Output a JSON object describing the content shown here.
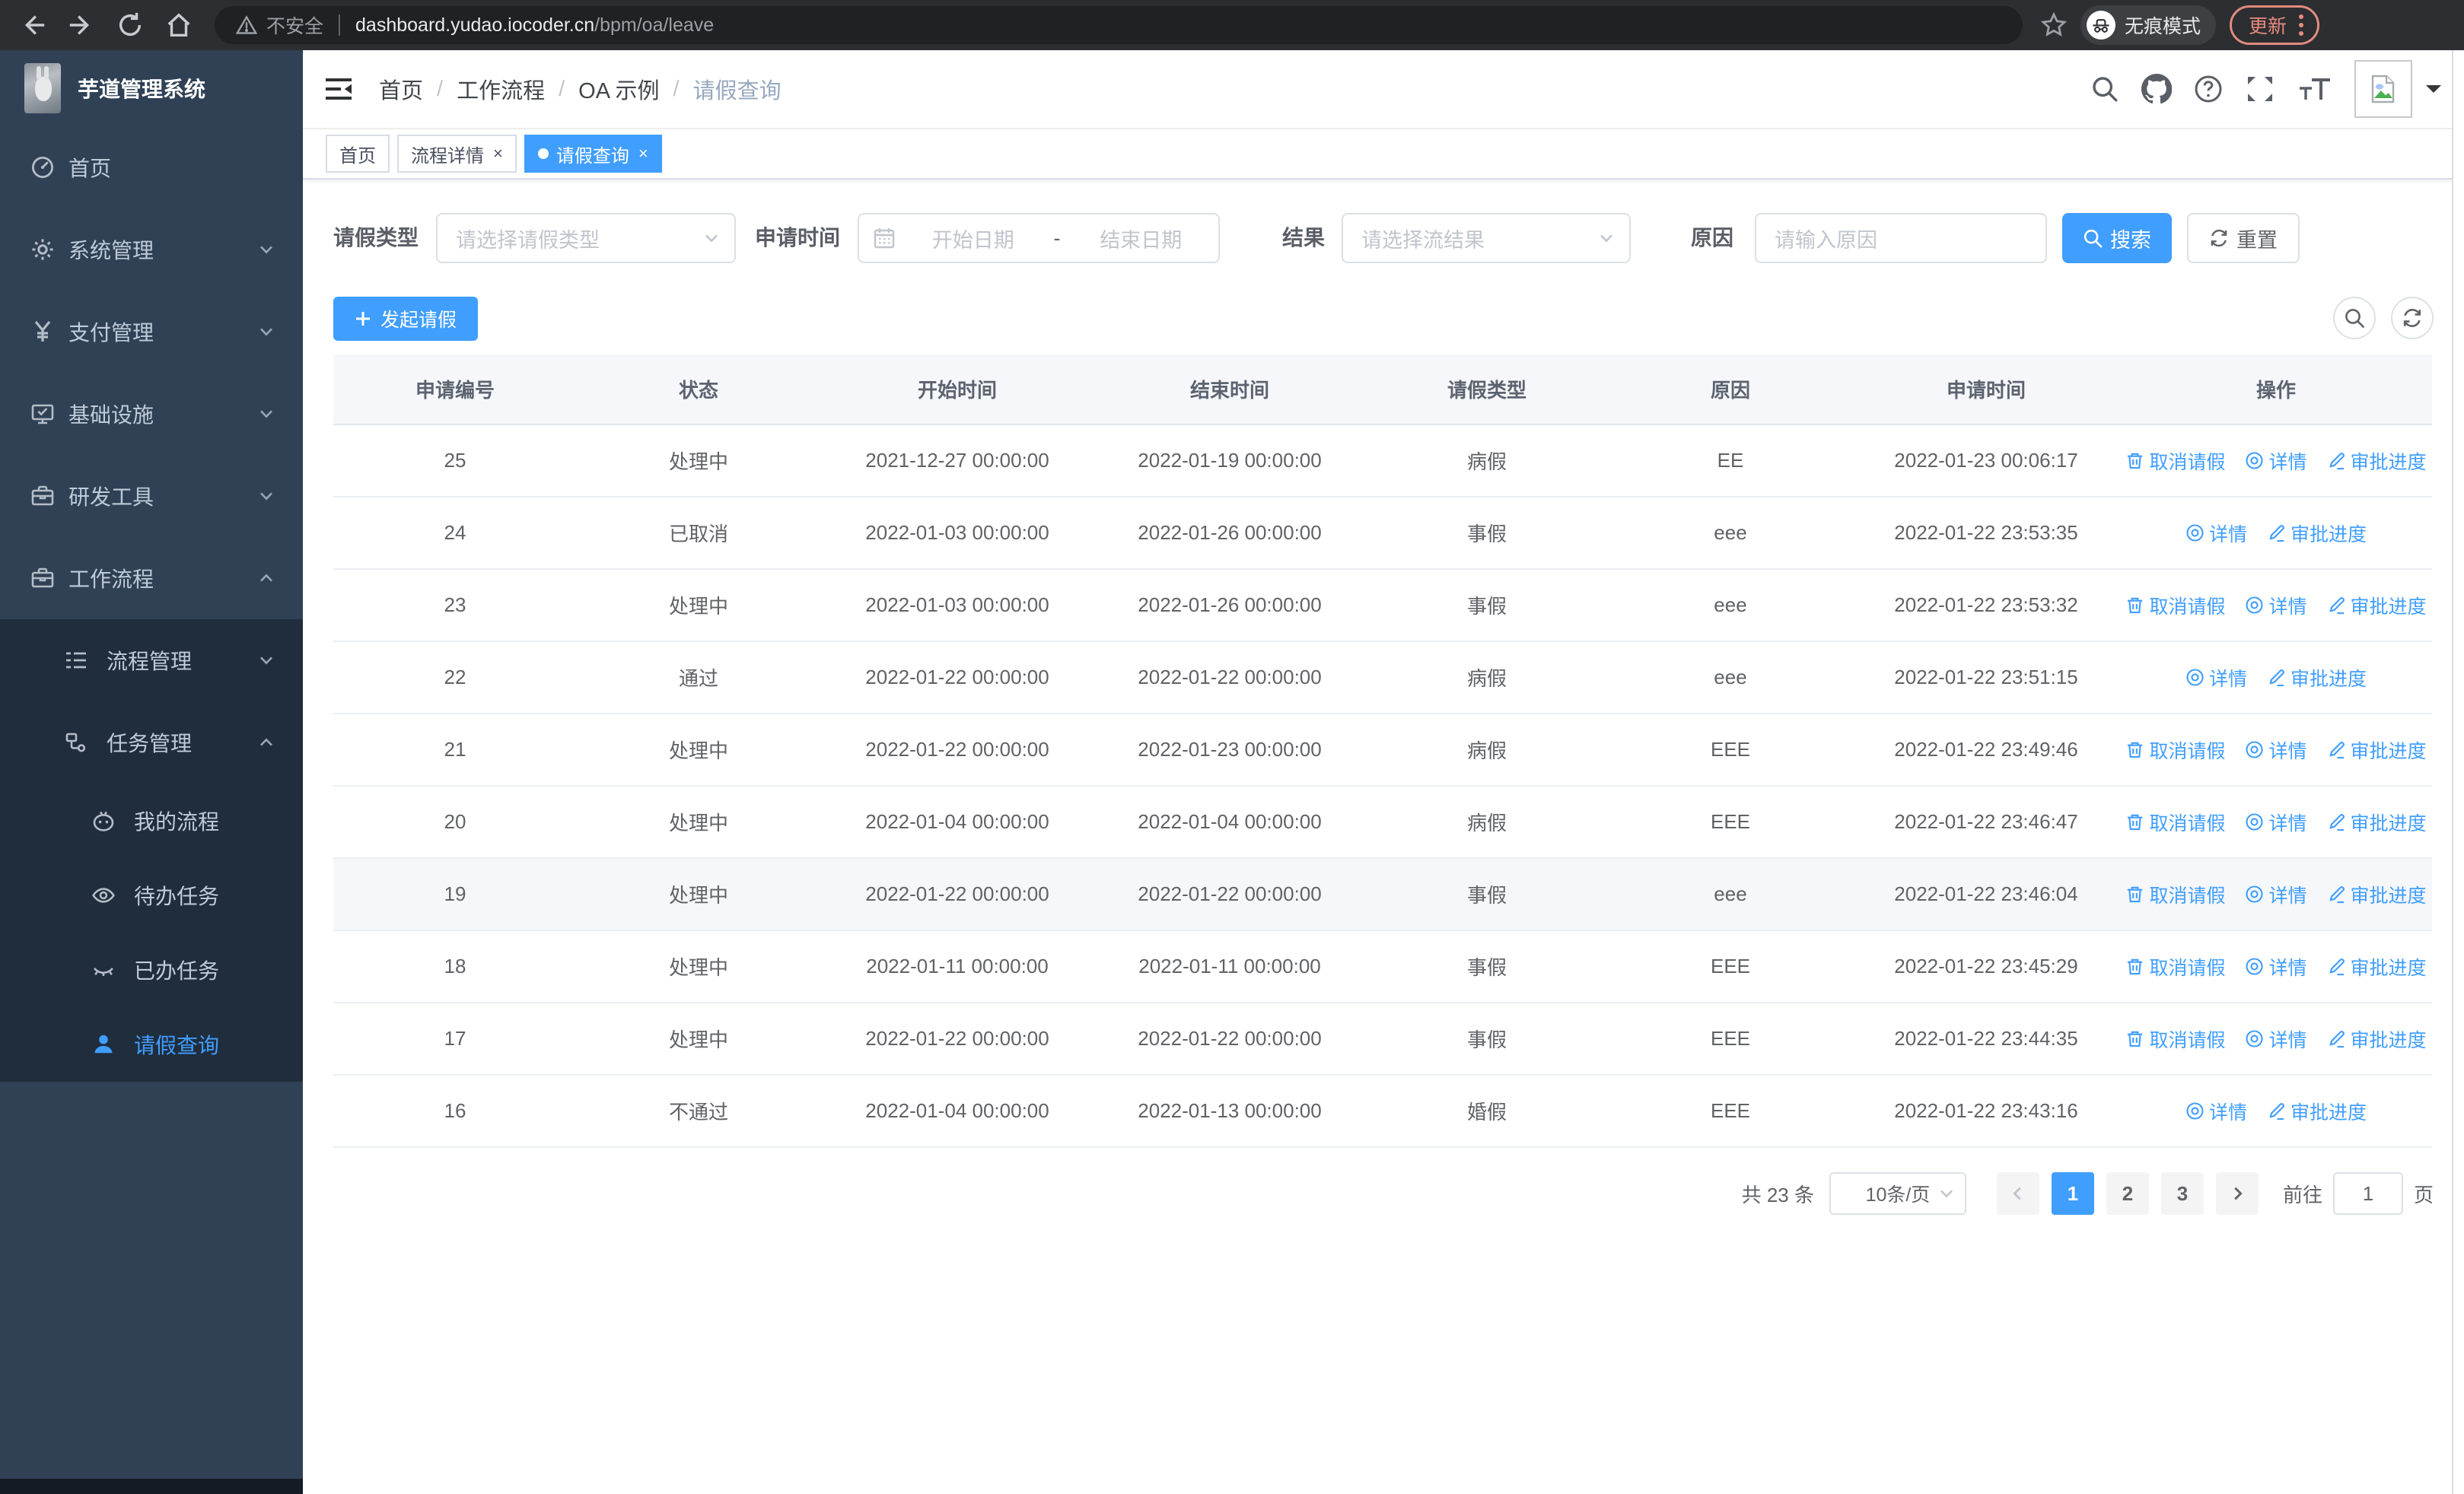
{
  "browser": {
    "security_label": "不安全",
    "url_host": "dashboard.yudao.iocoder.cn",
    "url_path": "/bpm/oa/leave",
    "incognito_label": "无痕模式",
    "update_label": "更新"
  },
  "sidebar": {
    "title": "芋道管理系统",
    "items": [
      {
        "key": "home",
        "label": "首页",
        "icon": "dashboard-icon",
        "level": 1,
        "chevron": "",
        "in_sub": false,
        "active": false
      },
      {
        "key": "system",
        "label": "系统管理",
        "icon": "gear-icon",
        "level": 1,
        "chevron": "down",
        "in_sub": false,
        "active": false
      },
      {
        "key": "payment",
        "label": "支付管理",
        "icon": "yen-icon",
        "level": 1,
        "chevron": "down",
        "in_sub": false,
        "active": false
      },
      {
        "key": "infra",
        "label": "基础设施",
        "icon": "monitor-icon",
        "level": 1,
        "chevron": "down",
        "in_sub": false,
        "active": false
      },
      {
        "key": "devtools",
        "label": "研发工具",
        "icon": "toolbox-icon",
        "level": 1,
        "chevron": "down",
        "in_sub": false,
        "active": false
      },
      {
        "key": "workflow",
        "label": "工作流程",
        "icon": "briefcase-icon",
        "level": 1,
        "chevron": "up",
        "in_sub": false,
        "active": false
      },
      {
        "key": "process-mgmt",
        "label": "流程管理",
        "icon": "tree-list-icon",
        "level": 2,
        "chevron": "down",
        "in_sub": true,
        "active": false
      },
      {
        "key": "task-mgmt",
        "label": "任务管理",
        "icon": "node-link-icon",
        "level": 2,
        "chevron": "up",
        "in_sub": true,
        "active": false
      },
      {
        "key": "my-process",
        "label": "我的流程",
        "icon": "robot-icon",
        "level": 3,
        "chevron": "",
        "in_sub": true,
        "active": false
      },
      {
        "key": "todo-task",
        "label": "待办任务",
        "icon": "eye-icon",
        "level": 3,
        "chevron": "",
        "in_sub": true,
        "active": false
      },
      {
        "key": "done-task",
        "label": "已办任务",
        "icon": "eye-closed-icon",
        "level": 3,
        "chevron": "",
        "in_sub": true,
        "active": false
      },
      {
        "key": "leave-query",
        "label": "请假查询",
        "icon": "user-icon",
        "level": 3,
        "chevron": "",
        "in_sub": true,
        "active": true
      }
    ]
  },
  "navbar": {
    "breadcrumbs": [
      "首页",
      "工作流程",
      "OA 示例",
      "请假查询"
    ]
  },
  "tags": [
    {
      "label": "首页",
      "closable": false,
      "active": false
    },
    {
      "label": "流程详情",
      "closable": true,
      "active": false
    },
    {
      "label": "请假查询",
      "closable": true,
      "active": true
    }
  ],
  "filters": {
    "leave_type_label": "请假类型",
    "leave_type_placeholder": "请选择请假类型",
    "apply_time_label": "申请时间",
    "start_date_placeholder": "开始日期",
    "range_separator": "-",
    "end_date_placeholder": "结束日期",
    "result_label": "结果",
    "result_placeholder": "请选择流结果",
    "reason_label": "原因",
    "reason_placeholder": "请输入原因",
    "search_label": "搜索",
    "reset_label": "重置"
  },
  "toolbar": {
    "create_label": "发起请假"
  },
  "table": {
    "columns": [
      "申请编号",
      "状态",
      "开始时间",
      "结束时间",
      "请假类型",
      "原因",
      "申请时间",
      "操作"
    ],
    "action_labels": {
      "cancel": "取消请假",
      "detail": "详情",
      "progress": "审批进度"
    },
    "rows": [
      {
        "id": "25",
        "status": "处理中",
        "start": "2021-12-27 00:00:00",
        "end": "2022-01-19 00:00:00",
        "type": "病假",
        "reason": "EE",
        "applied": "2022-01-23 00:06:17",
        "cancellable": true,
        "hover": false
      },
      {
        "id": "24",
        "status": "已取消",
        "start": "2022-01-03 00:00:00",
        "end": "2022-01-26 00:00:00",
        "type": "事假",
        "reason": "eee",
        "applied": "2022-01-22 23:53:35",
        "cancellable": false,
        "hover": false
      },
      {
        "id": "23",
        "status": "处理中",
        "start": "2022-01-03 00:00:00",
        "end": "2022-01-26 00:00:00",
        "type": "事假",
        "reason": "eee",
        "applied": "2022-01-22 23:53:32",
        "cancellable": true,
        "hover": false
      },
      {
        "id": "22",
        "status": "通过",
        "start": "2022-01-22 00:00:00",
        "end": "2022-01-22 00:00:00",
        "type": "病假",
        "reason": "eee",
        "applied": "2022-01-22 23:51:15",
        "cancellable": false,
        "hover": false
      },
      {
        "id": "21",
        "status": "处理中",
        "start": "2022-01-22 00:00:00",
        "end": "2022-01-23 00:00:00",
        "type": "病假",
        "reason": "EEE",
        "applied": "2022-01-22 23:49:46",
        "cancellable": true,
        "hover": false
      },
      {
        "id": "20",
        "status": "处理中",
        "start": "2022-01-04 00:00:00",
        "end": "2022-01-04 00:00:00",
        "type": "病假",
        "reason": "EEE",
        "applied": "2022-01-22 23:46:47",
        "cancellable": true,
        "hover": false
      },
      {
        "id": "19",
        "status": "处理中",
        "start": "2022-01-22 00:00:00",
        "end": "2022-01-22 00:00:00",
        "type": "事假",
        "reason": "eee",
        "applied": "2022-01-22 23:46:04",
        "cancellable": true,
        "hover": true
      },
      {
        "id": "18",
        "status": "处理中",
        "start": "2022-01-11 00:00:00",
        "end": "2022-01-11 00:00:00",
        "type": "事假",
        "reason": "EEE",
        "applied": "2022-01-22 23:45:29",
        "cancellable": true,
        "hover": false
      },
      {
        "id": "17",
        "status": "处理中",
        "start": "2022-01-22 00:00:00",
        "end": "2022-01-22 00:00:00",
        "type": "事假",
        "reason": "EEE",
        "applied": "2022-01-22 23:44:35",
        "cancellable": true,
        "hover": false
      },
      {
        "id": "16",
        "status": "不通过",
        "start": "2022-01-04 00:00:00",
        "end": "2022-01-13 00:00:00",
        "type": "婚假",
        "reason": "EEE",
        "applied": "2022-01-22 23:43:16",
        "cancellable": false,
        "hover": false
      }
    ]
  },
  "pagination": {
    "total_label": "共 23 条",
    "page_size_label": "10条/页",
    "pages": [
      "1",
      "2",
      "3"
    ],
    "active_page": "1",
    "goto_label": "前往",
    "goto_value": "1",
    "page_suffix": "页"
  },
  "colors": {
    "accent": "#409eff",
    "sidebar_bg": "#304156",
    "submenu_bg": "#1f2d3d"
  }
}
